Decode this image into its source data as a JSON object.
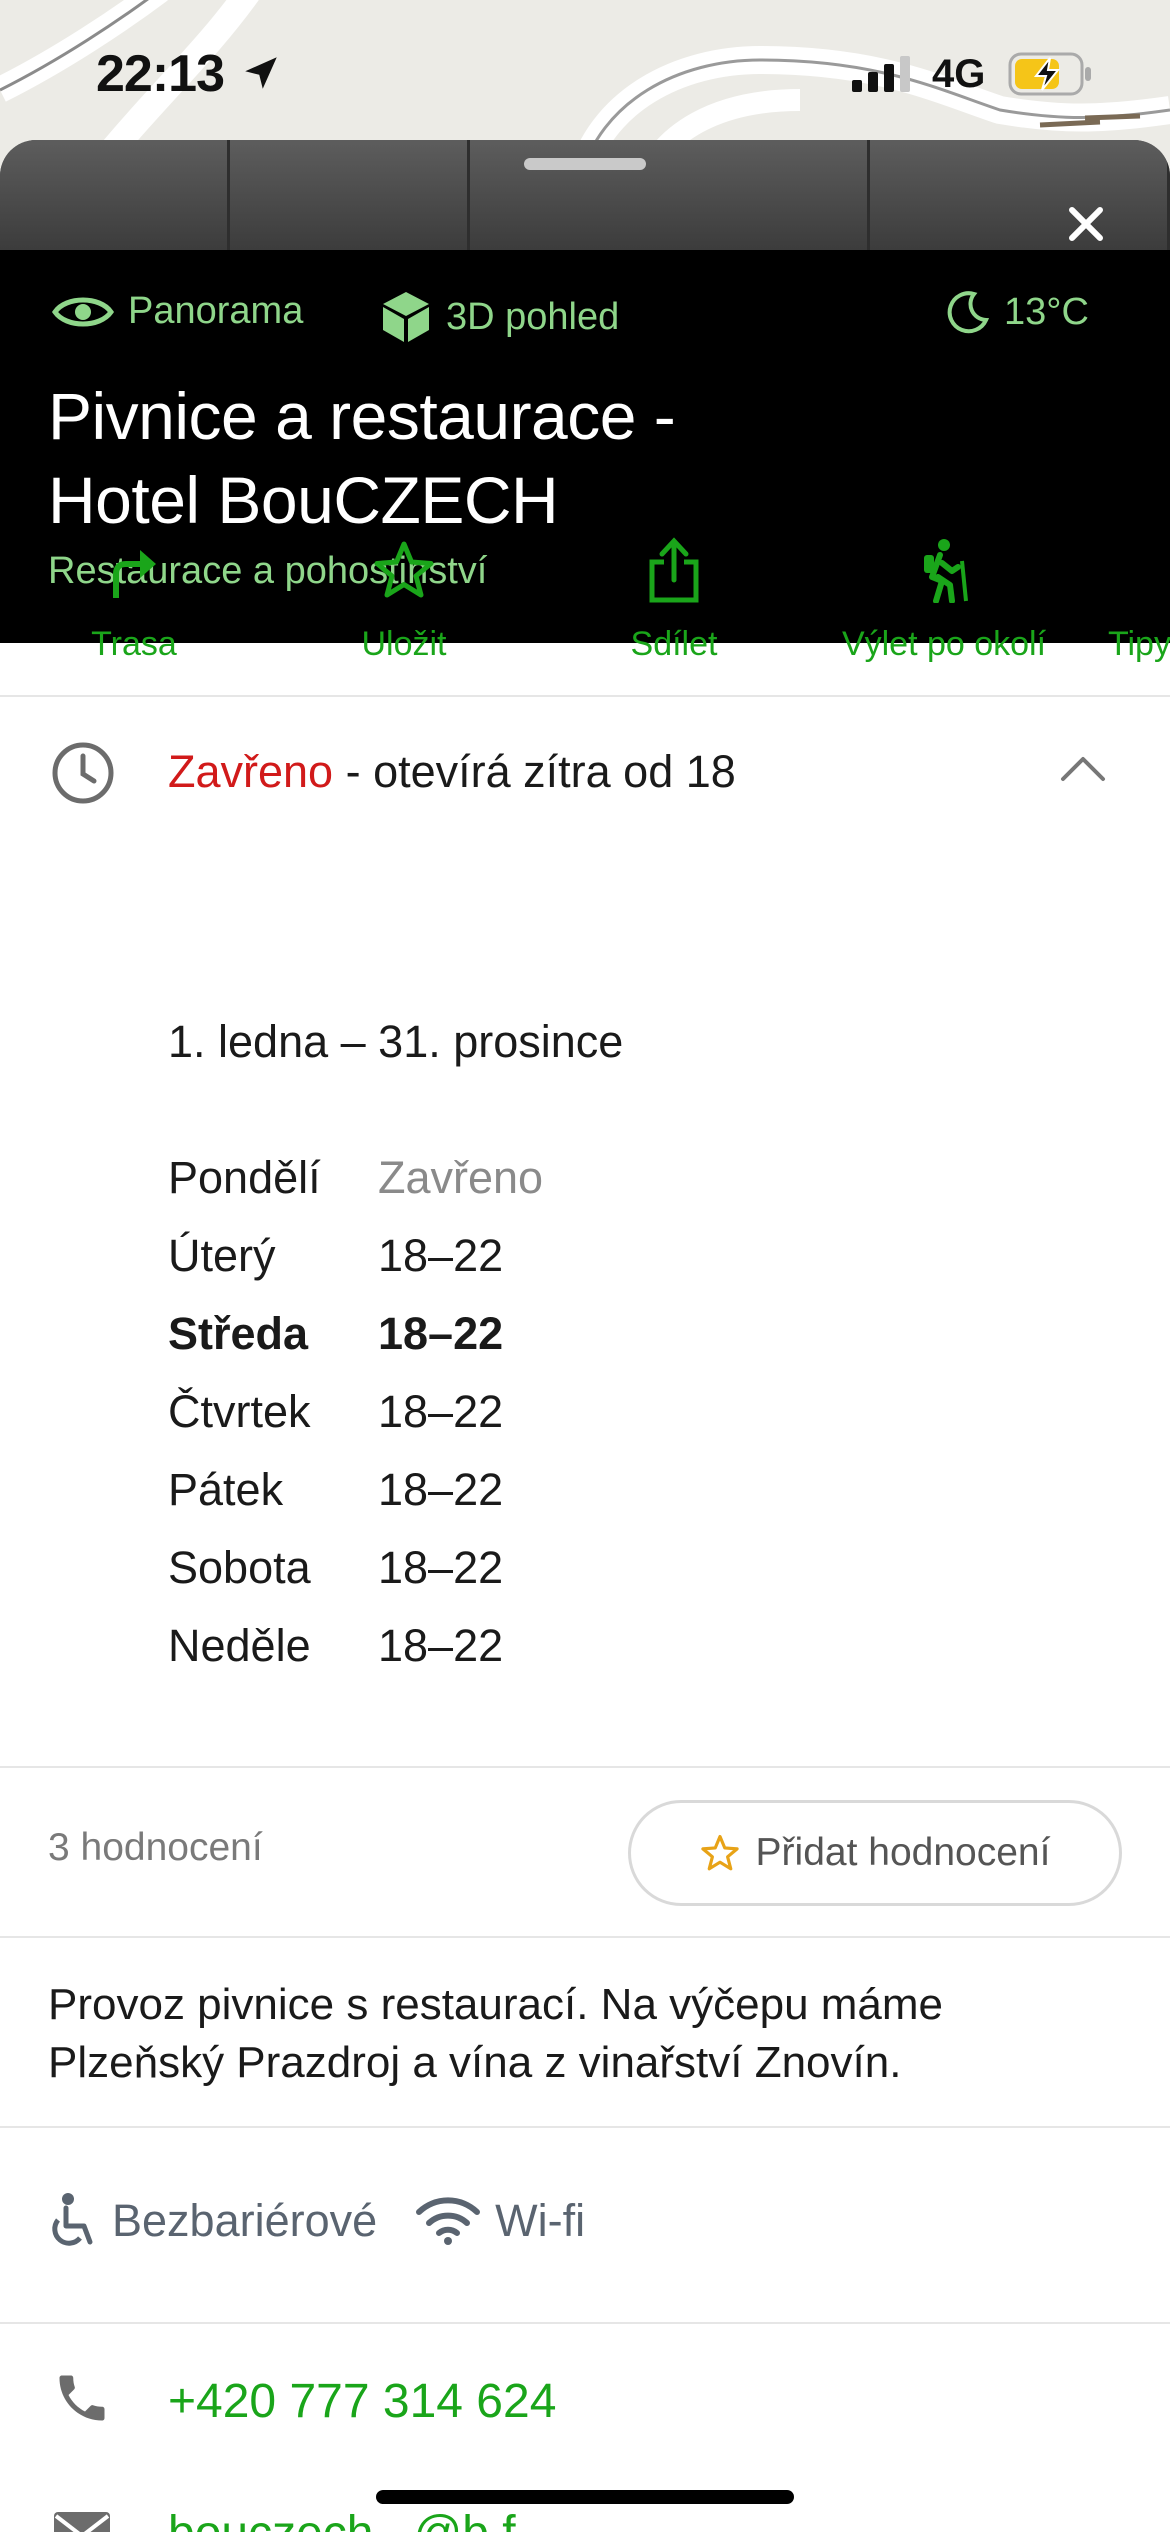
{
  "status_bar": {
    "time": "22:13",
    "network": "4G"
  },
  "header": {
    "links": {
      "panorama": "Panorama",
      "view_3d": "3D pohled"
    },
    "weather": "13°C",
    "title_line1": "Pivnice a restaurace -",
    "title_line2": "Hotel BouCZECH",
    "category": "Restaurace a pohostinství"
  },
  "actions": {
    "route": "Trasa",
    "save": "Uložit",
    "share": "Sdílet",
    "trip": "Výlet po okolí",
    "tips": "Tipy"
  },
  "hours": {
    "status": "Zavřeno",
    "summary": " - otevírá zítra od 18",
    "season": "1. ledna – 31. prosince",
    "days": [
      {
        "day": "Pondělí",
        "value": "Zavřeno"
      },
      {
        "day": "Úterý",
        "value": "18–22"
      },
      {
        "day": "Středa",
        "value": "18–22"
      },
      {
        "day": "Čtvrtek",
        "value": "18–22"
      },
      {
        "day": "Pátek",
        "value": "18–22"
      },
      {
        "day": "Sobota",
        "value": "18–22"
      },
      {
        "day": "Neděle",
        "value": "18–22"
      }
    ]
  },
  "reviews": {
    "count": "3 hodnocení",
    "add_label": "Přidat hodnocení"
  },
  "description": "Provoz pivnice s restaurací. Na výčepu máme Plzeňský Prazdroj a vína z vinařství Znovín.",
  "features": {
    "accessible": "Bezbariérové",
    "wifi": "Wi-fi"
  },
  "contact": {
    "phone": "+420 777 314 624",
    "email": "bouczech...@b.f..."
  },
  "colors": {
    "accent_green": "#1aa51a",
    "header_green": "#8fd68a",
    "closed_red": "#d11a1a"
  }
}
